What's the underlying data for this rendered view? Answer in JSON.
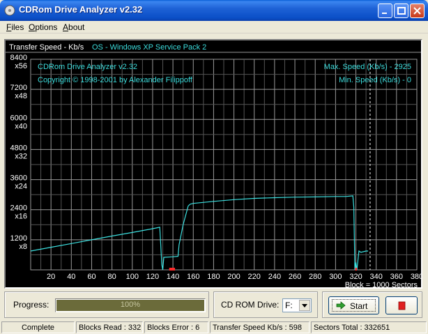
{
  "window": {
    "title": "CDRom Drive Analyzer v2.32"
  },
  "menu": [
    {
      "accel": "F",
      "rest": "iles"
    },
    {
      "accel": "O",
      "rest": "ptions"
    },
    {
      "accel": "A",
      "rest": "bout"
    }
  ],
  "chart_data": {
    "type": "line",
    "header_left": "Transfer Speed - Kb/s",
    "header_os": "OS - Windows XP Service Pack 2",
    "info_lines": [
      "CDRom Drive Analyzer v2.32",
      "Copyright © 1998-2001 by Alexander Filippoff"
    ],
    "max_speed": "Max. Speed (Kb/s) - 2925",
    "min_speed": "Min. Speed (Kb/s) - 0",
    "xlabel": "Block = 1000 Sectors",
    "xlim": [
      0,
      380
    ],
    "ylim": [
      0,
      8400
    ],
    "x_ticks": [
      20,
      40,
      60,
      80,
      100,
      120,
      140,
      160,
      180,
      200,
      220,
      240,
      260,
      280,
      300,
      320,
      340,
      360,
      380
    ],
    "y_ticks": [
      {
        "speed": "8400",
        "mult": "x56",
        "value": 8400
      },
      {
        "speed": "7200",
        "mult": "x48",
        "value": 7200
      },
      {
        "speed": "6000",
        "mult": "x40",
        "value": 6000
      },
      {
        "speed": "4800",
        "mult": "x32",
        "value": 4800
      },
      {
        "speed": "3600",
        "mult": "x24",
        "value": 3600
      },
      {
        "speed": "2400",
        "mult": "x16",
        "value": 2400
      },
      {
        "speed": "1200",
        "mult": "x8",
        "value": 1200
      }
    ],
    "grid": true,
    "series": [
      {
        "x": [
          0,
          20,
          40,
          60,
          80,
          100,
          120,
          127,
          128,
          129,
          130,
          131,
          140,
          145,
          146,
          150,
          155,
          157,
          160,
          180,
          200,
          220,
          240,
          260,
          280,
          300,
          310,
          317,
          318,
          319,
          320,
          321,
          323,
          325,
          330,
          332
        ],
        "y": [
          750,
          900,
          1050,
          1200,
          1350,
          1490,
          1640,
          1700,
          1000,
          200,
          0,
          500,
          520,
          540,
          1000,
          1800,
          2550,
          2620,
          2650,
          2730,
          2800,
          2850,
          2880,
          2900,
          2910,
          2925,
          2925,
          2950,
          2500,
          0,
          300,
          0,
          750,
          700,
          750,
          750
        ]
      }
    ],
    "error_marks_x": [
      137,
      138,
      139,
      140,
      141,
      320
    ],
    "position_marker_x": 334
  },
  "progress": {
    "label": "Progress:",
    "value": 100,
    "text": "100%"
  },
  "drive": {
    "label": "CD ROM Drive:",
    "selected": "F:"
  },
  "actions": {
    "start_label": "Start"
  },
  "colors": {
    "trace": "#3ce0e0",
    "text": "#3cdcdc",
    "grid": "#9a9a9a",
    "error_mark": "#ff2a2a"
  },
  "status": [
    "Complete",
    "Blocks Read : 332",
    "Blocks Error : 6",
    "Transfer Speed Kb/s : 598",
    "Sectors Total : 332651"
  ]
}
